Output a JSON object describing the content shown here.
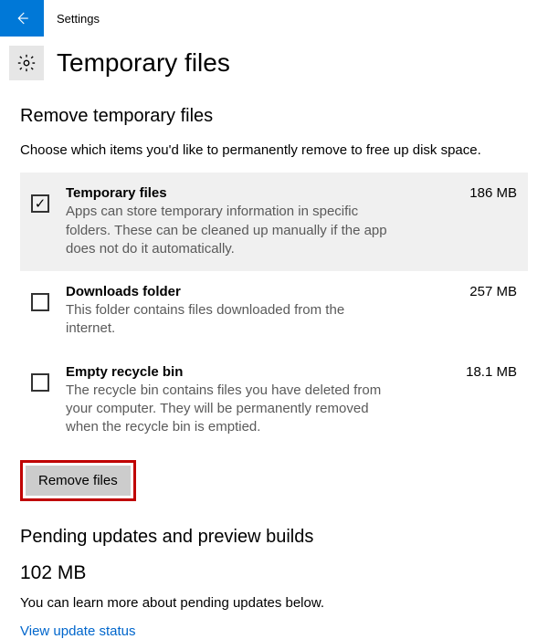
{
  "titlebar": {
    "label": "Settings"
  },
  "page": {
    "title": "Temporary files"
  },
  "remove": {
    "heading": "Remove temporary files",
    "description": "Choose which items you'd like to permanently remove to free up disk space.",
    "button": "Remove files"
  },
  "options": [
    {
      "title": "Temporary files",
      "size": "186 MB",
      "desc": "Apps can store temporary information in specific folders. These can be cleaned up manually if the app does not do it automatically.",
      "checked": true
    },
    {
      "title": "Downloads folder",
      "size": "257 MB",
      "desc": "This folder contains files downloaded from the internet.",
      "checked": false
    },
    {
      "title": "Empty recycle bin",
      "size": "18.1 MB",
      "desc": "The recycle bin contains files you have deleted from your computer. They will be permanently removed when the recycle bin is emptied.",
      "checked": false
    }
  ],
  "pending": {
    "heading": "Pending updates and preview builds",
    "size": "102 MB",
    "desc": "You can learn more about pending updates below.",
    "link": "View update status"
  }
}
